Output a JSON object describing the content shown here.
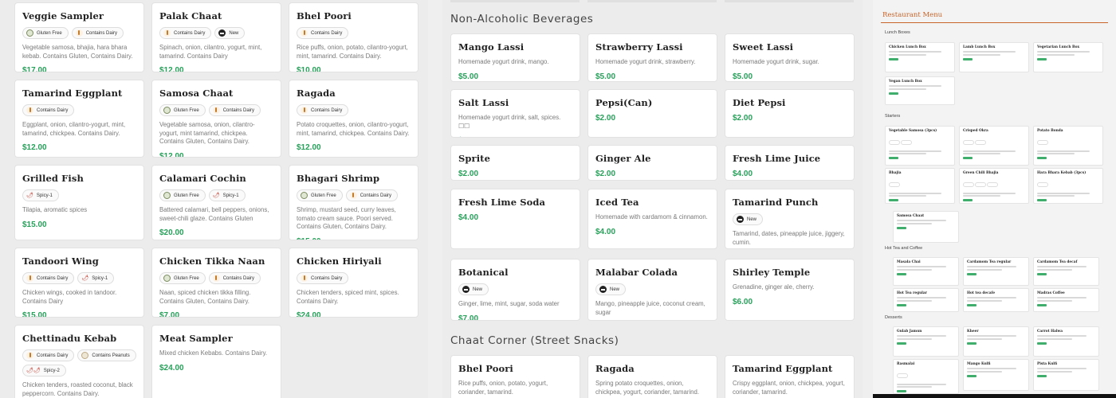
{
  "left_menu": [
    {
      "name": "Veggie Sampler",
      "badges": [
        {
          "type": "gf",
          "label": "Gluten Free"
        },
        {
          "type": "dairy",
          "label": "Contains Dairy"
        }
      ],
      "desc": "Vegetable samosa, bhajia, hara bhara kebab. Contains Gluten, Contains Dairy.",
      "price": "$17.00"
    },
    {
      "name": "Palak Chaat",
      "badges": [
        {
          "type": "dairy",
          "label": "Contains Dairy"
        },
        {
          "type": "new",
          "label": "New"
        }
      ],
      "desc": "Spinach, onion, cilantro, yogurt, mint, tamarind. Contains Dairy",
      "price": "$12.00"
    },
    {
      "name": "Bhel Poori",
      "badges": [
        {
          "type": "dairy",
          "label": "Contains Dairy"
        }
      ],
      "desc": "Rice puffs, onion, potato, cilantro-yogurt, mint, tamarind. Contains Dairy.",
      "price": "$10.00"
    },
    {
      "name": "Tamarind Eggplant",
      "badges": [
        {
          "type": "dairy",
          "label": "Contains Dairy"
        }
      ],
      "desc": "Eggplant, onion, cilantro-yogurt, mint, tamarind, chickpea. Contains Dairy.",
      "price": "$12.00"
    },
    {
      "name": "Samosa Chaat",
      "badges": [
        {
          "type": "gf",
          "label": "Gluten Free"
        },
        {
          "type": "dairy",
          "label": "Contains Dairy"
        }
      ],
      "desc": "Vegetable samosa, onion, cilantro-yogurt, mint tamarind, chickpea. Contains Gluten, Contains Dairy.",
      "price": "$12.00"
    },
    {
      "name": "Ragada",
      "badges": [
        {
          "type": "dairy",
          "label": "Contains Dairy"
        }
      ],
      "desc": "Potato croquettes, onion, cilantro-yogurt, mint, tamarind, chickpea. Contains Dairy.",
      "price": "$12.00"
    },
    {
      "name": "Grilled Fish",
      "badges": [
        {
          "type": "spicy",
          "label": "Spicy-1",
          "icon": "🌶"
        }
      ],
      "desc": "Tilapia, aromatic spices",
      "price": "$15.00"
    },
    {
      "name": "Calamari Cochin",
      "badges": [
        {
          "type": "gf",
          "label": "Gluten Free"
        },
        {
          "type": "spicy",
          "label": "Spicy-1",
          "icon": "🌶"
        }
      ],
      "desc": "Battered calamari, bell peppers, onions, sweet-chili glaze. Contains Gluten",
      "price": "$20.00"
    },
    {
      "name": "Bhagari Shrimp",
      "badges": [
        {
          "type": "gf",
          "label": "Gluten Free"
        },
        {
          "type": "dairy",
          "label": "Contains Dairy"
        }
      ],
      "desc": "Shrimp, mustard seed, curry leaves, tomato cream sauce. Poori served. Contains Gluten, Contains Dairy.",
      "price": "$15.00"
    },
    {
      "name": "Tandoori Wing",
      "badges": [
        {
          "type": "dairy",
          "label": "Contains Dairy"
        },
        {
          "type": "spicy",
          "label": "Spicy-1",
          "icon": "🌶"
        }
      ],
      "desc": "Chicken wings, cooked in tandoor. Contains Dairy",
      "price": "$15.00"
    },
    {
      "name": "Chicken Tikka Naan",
      "badges": [
        {
          "type": "gf",
          "label": "Gluten Free"
        },
        {
          "type": "dairy",
          "label": "Contains Dairy"
        }
      ],
      "desc": "Naan, spiced chicken tikka filling. Contains Gluten, Contains Dairy.",
      "price": "$7.00"
    },
    {
      "name": "Chicken Hiriyali",
      "badges": [
        {
          "type": "dairy",
          "label": "Contains Dairy"
        }
      ],
      "desc": "Chicken tenders, spiced mint, spices. Contains Dairy.",
      "price": "$24.00"
    },
    {
      "name": "Chettinadu Kebab",
      "badges": [
        {
          "type": "dairy",
          "label": "Contains Dairy"
        },
        {
          "type": "peanut",
          "label": "Contains Peanuts"
        },
        {
          "type": "spicy",
          "label": "Spicy-2",
          "icon": "🌶🌶"
        }
      ],
      "desc": "Chicken tenders, roasted coconut, black peppercorn. Contains Dairy.",
      "price": "$24.00"
    },
    {
      "name": "Meat Sampler",
      "badges": [],
      "desc": "Mixed chicken Kebabs. Contains Dairy.",
      "price": "$24.00"
    }
  ],
  "beverages": {
    "title": "Non-Alcoholic Beverages",
    "items": [
      {
        "name": "Mango Lassi",
        "badges": [],
        "desc": "Homemade yogurt drink, mango.",
        "price": "$5.00"
      },
      {
        "name": "Strawberry Lassi",
        "badges": [],
        "desc": "Homemade yogurt drink, strawberry.",
        "price": "$5.00"
      },
      {
        "name": "Sweet Lassi",
        "badges": [],
        "desc": "Homemade yogurt drink, sugar.",
        "price": "$5.00"
      },
      {
        "name": "Salt Lassi",
        "badges": [],
        "desc": "Homemade yogurt drink, salt, spices. ☐☐",
        "price": "$5.00"
      },
      {
        "name": "Pepsi(Can)",
        "badges": [],
        "desc": "",
        "price": "$2.00"
      },
      {
        "name": "Diet Pepsi",
        "badges": [],
        "desc": "",
        "price": "$2.00"
      },
      {
        "name": "Sprite",
        "badges": [],
        "desc": "",
        "price": "$2.00"
      },
      {
        "name": "Ginger Ale",
        "badges": [],
        "desc": "",
        "price": "$2.00"
      },
      {
        "name": "Fresh Lime Juice",
        "badges": [],
        "desc": "",
        "price": "$4.00"
      },
      {
        "name": "Fresh Lime Soda",
        "badges": [],
        "desc": "",
        "price": "$4.00"
      },
      {
        "name": "Iced Tea",
        "badges": [],
        "desc": "Homemade with cardamom & cinnamon.",
        "price": "$4.00"
      },
      {
        "name": "Tamarind Punch",
        "badges": [
          {
            "type": "new",
            "label": "New"
          }
        ],
        "desc": "Tamarind, dates, pineapple juice, jiggery, cumin.",
        "price": "$7.00"
      },
      {
        "name": "Botanical",
        "badges": [
          {
            "type": "new",
            "label": "New"
          }
        ],
        "desc": "Ginger, lime, mint, sugar, soda water",
        "price": "$7.00"
      },
      {
        "name": "Malabar Colada",
        "badges": [
          {
            "type": "new",
            "label": "New"
          }
        ],
        "desc": "Mango, pineapple juice, coconut cream, sugar",
        "price": "$8.00"
      },
      {
        "name": "Shirley Temple",
        "badges": [],
        "desc": "Grenadine, ginger ale, cherry.",
        "price": "$6.00"
      }
    ]
  },
  "chaat": {
    "title": "Chaat Corner (Street Snacks)",
    "items": [
      {
        "name": "Bhel Poori",
        "badges": [],
        "desc": "Rice puffs, onion, potato, yogurt, coriander, tamarind.",
        "price": ""
      },
      {
        "name": "Ragada",
        "badges": [],
        "desc": "Spring potato croquettes, onion, chickpea, yogurt, coriander, tamarind.",
        "price": ""
      },
      {
        "name": "Tamarind Eggplant",
        "badges": [],
        "desc": "Crispy eggplant, onion, chickpea, yogurt, coriander, tamarind.",
        "price": ""
      }
    ]
  },
  "mini": {
    "title": "Restaurant Menu",
    "sections": [
      {
        "label": "Lunch Boxes",
        "items": [
          "Chicken Lunch Box",
          "Lamb Lunch Box",
          "Vegetarian Lunch Box",
          "Vegan Lunch Box"
        ]
      },
      {
        "label": "Starters",
        "items": [
          "Vegetable Samosa (3pcs)",
          "Crisped Okra",
          "Potato Bonda",
          "Bhajia",
          "Green Chili Bhajia",
          "Hara Bhara Kebab (3pcs)"
        ]
      },
      {
        "label": "Hot Tea and Coffee",
        "items": [
          "Masala Chai",
          "Cardamom Tea regular",
          "Cardamom Tea decaf",
          "Hot Tea regular",
          "Hot tea decafe",
          "Madras Coffee"
        ]
      },
      {
        "label": "Desserts",
        "items": [
          "Gulab Jamun",
          "Kheer",
          "Carrot Halwa",
          "Rasmalai",
          "Mango Kulfi",
          "Pista Kulfi"
        ]
      }
    ],
    "extra": "Samosa Chaat"
  }
}
